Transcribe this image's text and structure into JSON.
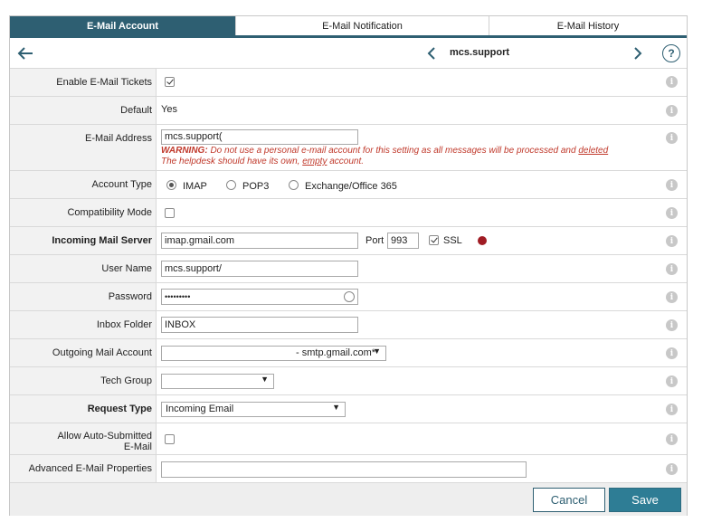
{
  "tabs": [
    {
      "label": "E-Mail Account",
      "active": true
    },
    {
      "label": "E-Mail Notification",
      "active": false
    },
    {
      "label": "E-Mail History",
      "active": false
    }
  ],
  "nav": {
    "title": "mcs.support",
    "help": "?"
  },
  "fields": {
    "enable_tickets": {
      "label": "Enable E-Mail Tickets",
      "checked": true
    },
    "default": {
      "label": "Default",
      "value": "Yes"
    },
    "email_address": {
      "label": "E-Mail Address",
      "value": "mcs.support(",
      "warning_prefix": "WARNING:",
      "warning_text_1": " Do not use a personal e-mail account for this setting as all messages will be processed and ",
      "warning_link_1": "deleted",
      "warning_text_2": "The helpdesk should have its own, ",
      "warning_link_2": "empty",
      "warning_text_3": " account."
    },
    "account_type": {
      "label": "Account Type",
      "options": [
        "IMAP",
        "POP3",
        "Exchange/Office 365"
      ],
      "selected": "IMAP"
    },
    "compatibility_mode": {
      "label": "Compatibility Mode",
      "checked": false
    },
    "incoming_server": {
      "label": "Incoming Mail Server",
      "value": "imap.gmail.com",
      "port_label": "Port",
      "port_value": "993",
      "ssl_label": "SSL",
      "ssl_checked": true
    },
    "user_name": {
      "label": "User Name",
      "value": "mcs.support/"
    },
    "password": {
      "label": "Password",
      "value": "•••••••••"
    },
    "inbox_folder": {
      "label": "Inbox Folder",
      "value": "INBOX"
    },
    "outgoing_account": {
      "label": "Outgoing Mail Account",
      "value": "- smtp.gmail.com*"
    },
    "tech_group": {
      "label": "Tech Group",
      "value": ""
    },
    "request_type": {
      "label": "Request Type",
      "value": "Incoming Email"
    },
    "auto_submitted": {
      "label_1": "Allow Auto-Submitted",
      "label_2": "E-Mail",
      "checked": false
    },
    "advanced_properties": {
      "label": "Advanced E-Mail Properties",
      "value": ""
    }
  },
  "footer": {
    "cancel_label": "Cancel",
    "save_label": "Save"
  },
  "colors": {
    "brand": "#2e5f72",
    "save": "#2e7d95",
    "warning": "#c0392b",
    "status_dot": "#a01c24"
  },
  "icons": {
    "back": "arrow-left-icon",
    "prev": "chevron-left-icon",
    "next": "chevron-right-icon",
    "info": "info-icon",
    "help": "question-circle-icon"
  }
}
